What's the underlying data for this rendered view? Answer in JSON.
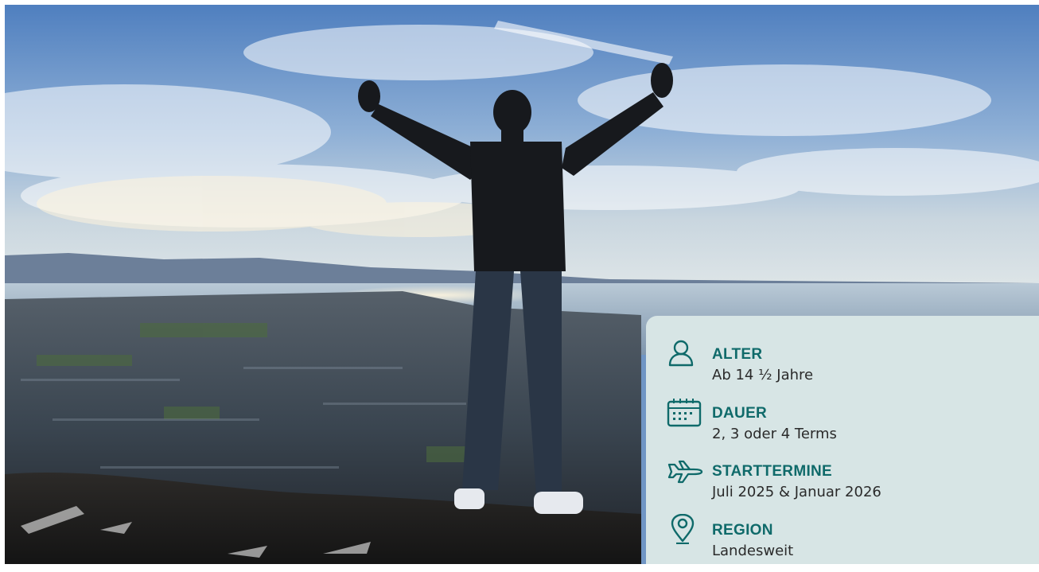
{
  "hero": {
    "alt": "Person mit ausgebreiteten Armen auf einem Berggipfel über einer Stadt und Küste"
  },
  "colors": {
    "accent": "#0f6a6a",
    "card_bg": "#d7e5e5",
    "text": "#2a2a2a"
  },
  "info": [
    {
      "icon": "person-icon",
      "label": "ALTER",
      "value": "Ab 14 ½ Jahre"
    },
    {
      "icon": "calendar-icon",
      "label": "DAUER",
      "value": "2, 3 oder 4 Terms"
    },
    {
      "icon": "airplane-icon",
      "label": "STARTTERMINE",
      "value": "Juli 2025 & Januar 2026"
    },
    {
      "icon": "map-pin-icon",
      "label": "REGION",
      "value": "Landesweit"
    }
  ]
}
